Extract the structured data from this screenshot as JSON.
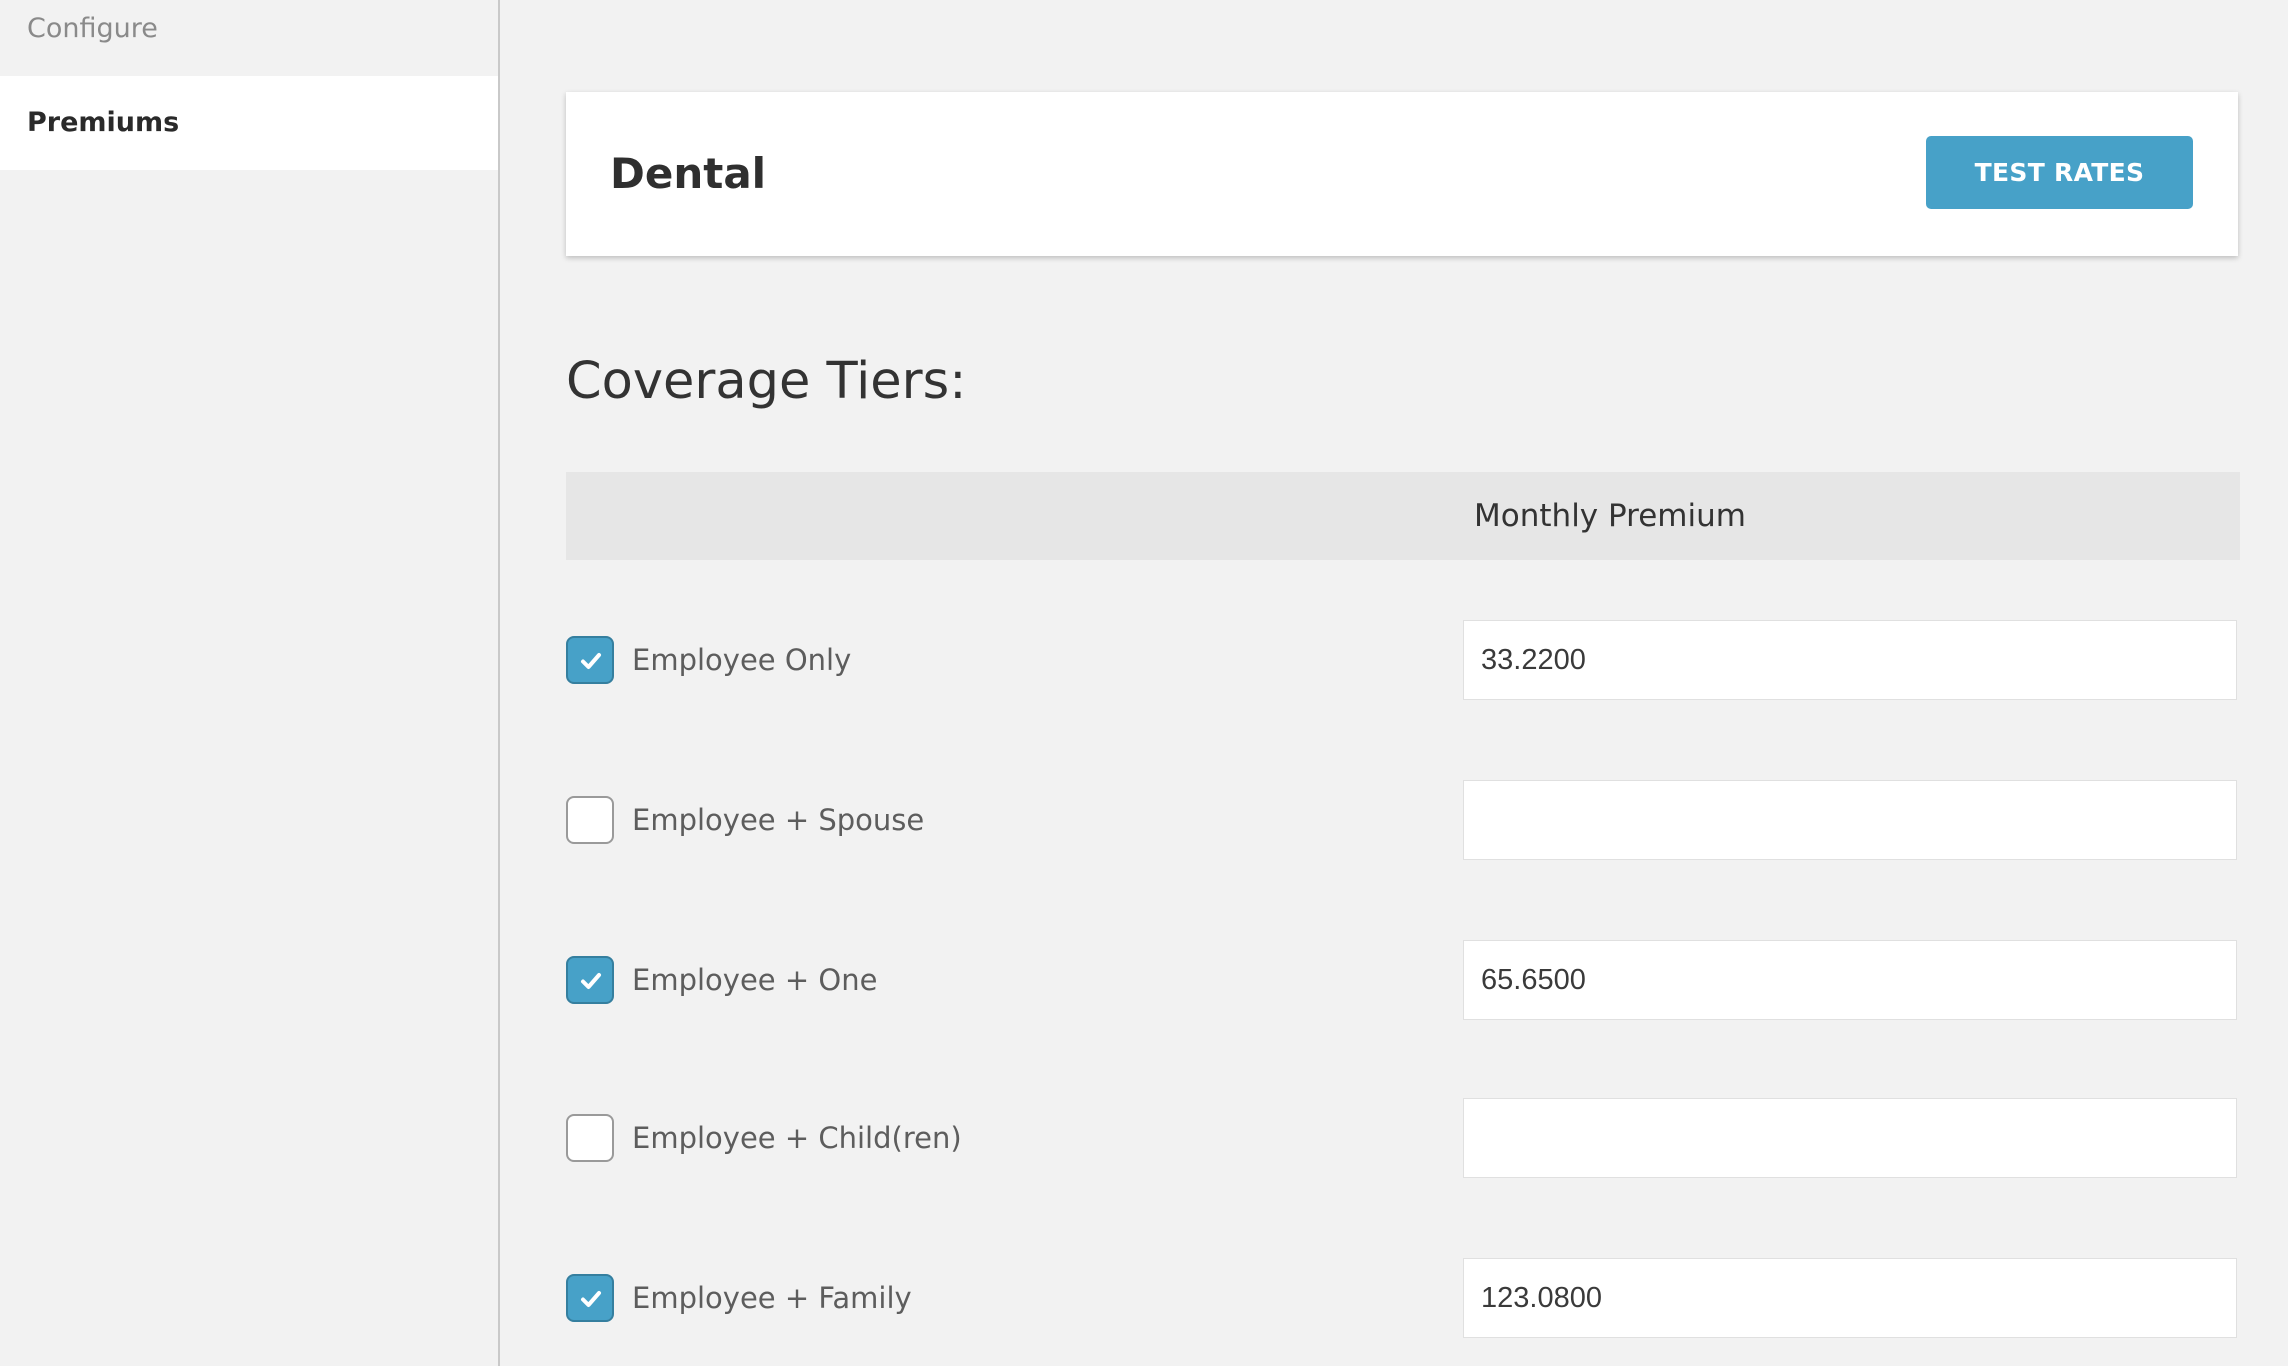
{
  "sidebar": {
    "items": [
      {
        "label": "Configure",
        "active": false
      },
      {
        "label": "Premiums",
        "active": true
      }
    ]
  },
  "header": {
    "title": "Dental",
    "button_label": "TEST RATES"
  },
  "coverage": {
    "title": "Coverage Tiers:",
    "column_header": "Monthly Premium",
    "tiers": [
      {
        "label": "Employee Only",
        "checked": true,
        "monthly_premium": "33.2200"
      },
      {
        "label": "Employee + Spouse",
        "checked": false,
        "monthly_premium": ""
      },
      {
        "label": "Employee + One",
        "checked": true,
        "monthly_premium": "65.6500"
      },
      {
        "label": "Employee + Child(ren)",
        "checked": false,
        "monthly_premium": ""
      },
      {
        "label": "Employee + Family",
        "checked": true,
        "monthly_premium": "123.0800"
      }
    ]
  },
  "colors": {
    "accent": "#47a1c8",
    "background": "#f2f2f2",
    "card": "#ffffff",
    "table_header": "#e6e6e6"
  }
}
